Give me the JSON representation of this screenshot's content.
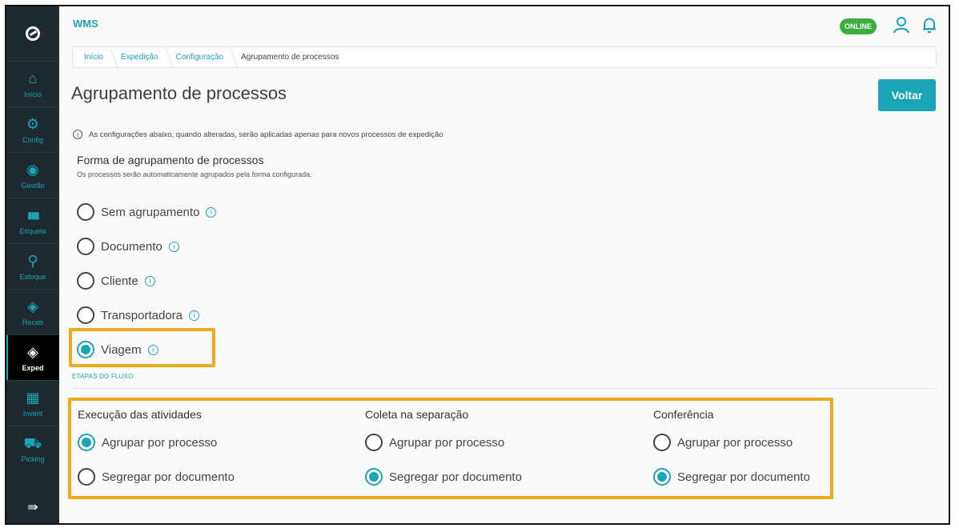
{
  "app": {
    "title": "WMS",
    "status_badge": "ONLINE"
  },
  "sidebar": {
    "items": [
      {
        "label": "Início",
        "icon": "home-icon",
        "glyph": "⌂"
      },
      {
        "label": "Config",
        "icon": "gear-icon",
        "glyph": "⚙"
      },
      {
        "label": "Gestão",
        "icon": "location-pin-icon",
        "glyph": "◉"
      },
      {
        "label": "Etiqueta",
        "icon": "barcode-icon",
        "glyph": "▮▮▮"
      },
      {
        "label": "Estoque",
        "icon": "search-icon",
        "glyph": "⚲"
      },
      {
        "label": "Receb",
        "icon": "box-icon",
        "glyph": "◈"
      },
      {
        "label": "Exped",
        "icon": "box-icon",
        "glyph": "◈",
        "active": true
      },
      {
        "label": "Invent",
        "icon": "building-icon",
        "glyph": "▦"
      },
      {
        "label": "Picking",
        "icon": "hand-truck-icon",
        "glyph": "⛟"
      }
    ],
    "collapse_glyph": "⇛"
  },
  "breadcrumb": [
    "Início",
    "Expedição",
    "Configuração",
    "Agrupamento de processos"
  ],
  "page": {
    "title": "Agrupamento de processos",
    "back_label": "Voltar",
    "info_text": "As configurações abaixo, quando alteradas, serão aplicadas apenas para novos processos de expedição"
  },
  "grouping": {
    "title": "Forma de agrupamento de processos",
    "subtitle": "Os processos serão automaticamente agrupados pela forma configurada.",
    "options": [
      {
        "label": "Sem agrupamento",
        "checked": false
      },
      {
        "label": "Documento",
        "checked": false
      },
      {
        "label": "Cliente",
        "checked": false
      },
      {
        "label": "Transportadora",
        "checked": false
      },
      {
        "label": "Viagem",
        "checked": true
      }
    ]
  },
  "steps": {
    "label": "ETAPAS DO FLUXO",
    "columns": [
      {
        "title": "Execução das atividades",
        "options": [
          "Agrupar por processo",
          "Segregar por documento"
        ],
        "selected": 0
      },
      {
        "title": "Coleta na separação",
        "options": [
          "Agrupar por processo",
          "Segregar por documento"
        ],
        "selected": 1
      },
      {
        "title": "Conferência",
        "options": [
          "Agrupar por processo",
          "Segregar por documento"
        ],
        "selected": 1
      }
    ]
  },
  "colors": {
    "accent": "#1aa4b5",
    "online": "#3cae3f",
    "highlight": "#f0a81c",
    "sidebar": "#1f2a30"
  }
}
